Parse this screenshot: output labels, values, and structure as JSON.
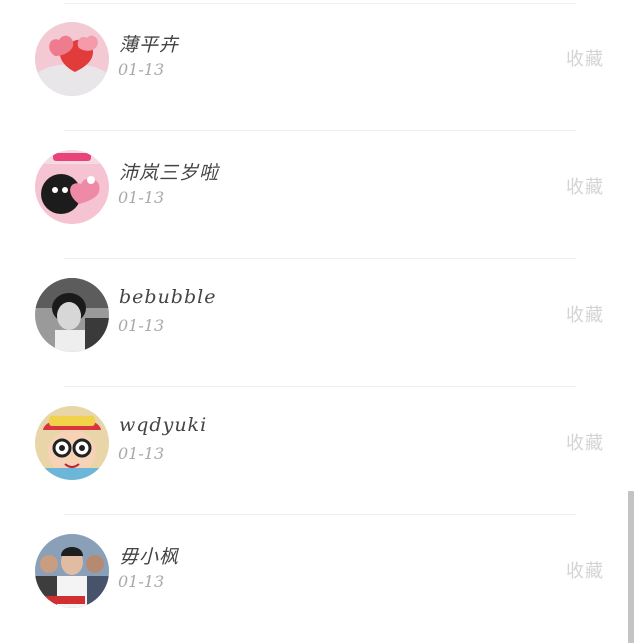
{
  "items": [
    {
      "name": "薄平卉",
      "date": "01-13",
      "action": "收藏",
      "avatar": "hearts-avatar"
    },
    {
      "name": "沛岚三岁啦",
      "date": "01-13",
      "action": "收藏",
      "avatar": "cartoon-love-avatar"
    },
    {
      "name": "bebubble",
      "date": "01-13",
      "action": "收藏",
      "avatar": "bw-portrait-avatar"
    },
    {
      "name": "wqdyuki",
      "date": "01-13",
      "action": "收藏",
      "avatar": "arale-cartoon-avatar"
    },
    {
      "name": "毋小枫",
      "date": "01-13",
      "action": "收藏",
      "avatar": "group-photo-avatar"
    }
  ],
  "colors": {
    "name": "#444444",
    "date": "#a9a9a9",
    "action": "#d4d4d4",
    "divider": "#efefef"
  }
}
